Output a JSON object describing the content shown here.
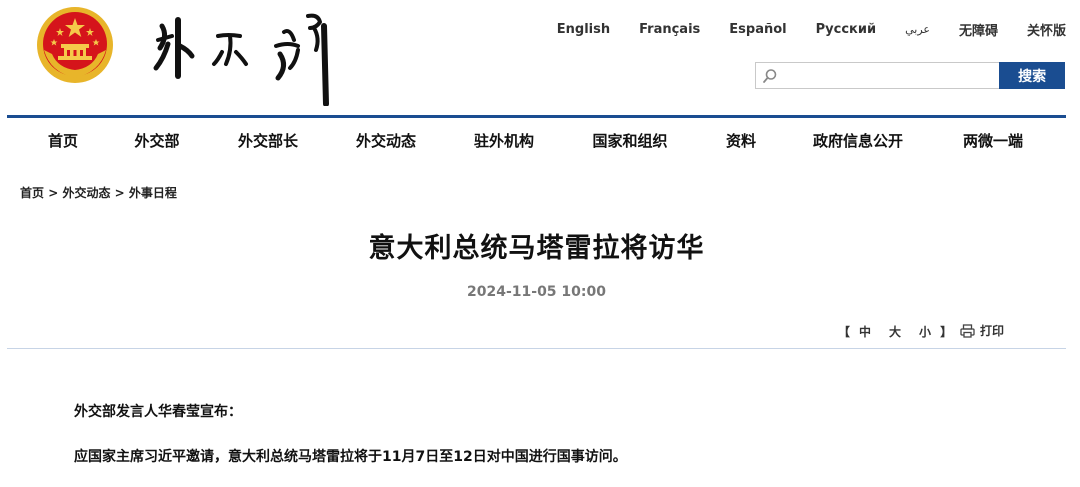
{
  "languages": [
    "English",
    "Français",
    "Español",
    "Русский",
    "عربي",
    "无障碍",
    "关怀版"
  ],
  "search": {
    "placeholder": "",
    "button_label": "搜索"
  },
  "nav": [
    "首页",
    "外交部",
    "外交部长",
    "外交动态",
    "驻外机构",
    "国家和组织",
    "资料",
    "政府信息公开",
    "两微一端"
  ],
  "breadcrumb": {
    "items": [
      "首页",
      "外交动态",
      "外事日程"
    ],
    "separator": ">"
  },
  "article": {
    "title": "意大利总统马塔雷拉将访华",
    "timestamp": "2024-11-05 10:00",
    "font_size_label": {
      "open": "【",
      "large": "中",
      "medium": "大",
      "small": "小",
      "close": "】"
    },
    "print_label": "打印",
    "paragraphs": [
      "外交部发言人华春莹宣布：",
      "应国家主席习近平邀请，意大利总统马塔雷拉将于11月7日至12日对中国进行国事访问。"
    ]
  },
  "colors": {
    "accent": "#1a4d91",
    "emblem_red": "#d5141b",
    "emblem_gold": "#e8b52a"
  },
  "icons": {
    "emblem": "national-emblem-icon",
    "search": "search-icon",
    "print": "printer-icon"
  }
}
